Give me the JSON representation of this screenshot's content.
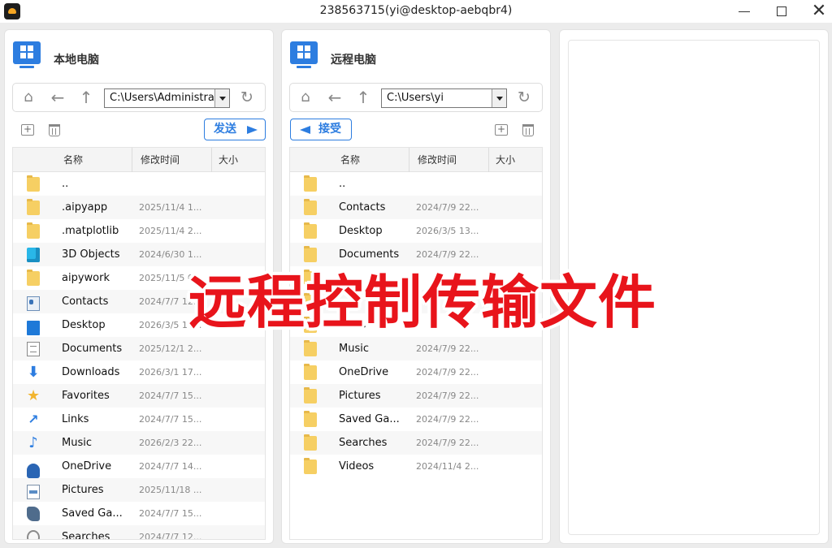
{
  "window": {
    "title": "238563715(yi@desktop-aebqbr4)",
    "minimize_icon": "minimize-icon",
    "maximize_icon": "maximize-icon",
    "close_icon": "close-icon"
  },
  "local": {
    "title": "本地电脑",
    "path": "C:\\Users\\Administrator",
    "action_label": "发送",
    "columns": [
      "名称",
      "修改时间",
      "大小"
    ],
    "files": [
      {
        "name": "..",
        "modified": "",
        "icon": "folder-icon"
      },
      {
        "name": ".aipyapp",
        "modified": "2025/11/4 1...",
        "icon": "folder-icon"
      },
      {
        "name": ".matplotlib",
        "modified": "2025/11/4 2...",
        "icon": "folder-icon"
      },
      {
        "name": "3D Objects",
        "modified": "2024/6/30 1...",
        "icon": "cube-icon"
      },
      {
        "name": "aipywork",
        "modified": "2025/11/5 0...",
        "icon": "folder-icon"
      },
      {
        "name": "Contacts",
        "modified": "2024/7/7 12...",
        "icon": "contacts-icon"
      },
      {
        "name": "Desktop",
        "modified": "2026/3/5 10...",
        "icon": "desktop-icon"
      },
      {
        "name": "Documents",
        "modified": "2025/12/1 2...",
        "icon": "documents-icon"
      },
      {
        "name": "Downloads",
        "modified": "2026/3/1 17...",
        "icon": "download-icon"
      },
      {
        "name": "Favorites",
        "modified": "2024/7/7 15...",
        "icon": "star-icon"
      },
      {
        "name": "Links",
        "modified": "2024/7/7 15...",
        "icon": "link-icon"
      },
      {
        "name": "Music",
        "modified": "2026/2/3 22...",
        "icon": "music-icon"
      },
      {
        "name": "OneDrive",
        "modified": "2024/7/7 14...",
        "icon": "cloud-icon"
      },
      {
        "name": "Pictures",
        "modified": "2025/11/18 ...",
        "icon": "pictures-icon"
      },
      {
        "name": "Saved Ga...",
        "modified": "2024/7/7 15...",
        "icon": "games-icon"
      },
      {
        "name": "Searches",
        "modified": "2024/7/7 12...",
        "icon": "search-icon"
      }
    ]
  },
  "remote": {
    "title": "远程电脑",
    "path": "C:\\Users\\yi",
    "action_label": "接受",
    "columns": [
      "名称",
      "修改时间",
      "大小"
    ],
    "files": [
      {
        "name": "..",
        "modified": "",
        "icon": "folder-icon"
      },
      {
        "name": "Contacts",
        "modified": "2024/7/9 22...",
        "icon": "folder-icon"
      },
      {
        "name": "Desktop",
        "modified": "2026/3/5 13...",
        "icon": "folder-icon"
      },
      {
        "name": "Documents",
        "modified": "2024/7/9 22...",
        "icon": "folder-icon"
      },
      {
        "name": "",
        "modified": "",
        "icon": "folder-icon"
      },
      {
        "name": "",
        "modified": "",
        "icon": "folder-icon"
      },
      {
        "name": "Links",
        "modified": "",
        "icon": "folder-icon"
      },
      {
        "name": "Music",
        "modified": "2024/7/9 22...",
        "icon": "folder-icon"
      },
      {
        "name": "OneDrive",
        "modified": "2024/7/9 22...",
        "icon": "folder-icon"
      },
      {
        "name": "Pictures",
        "modified": "2024/7/9 22...",
        "icon": "folder-icon"
      },
      {
        "name": "Saved Ga...",
        "modified": "2024/7/9 22...",
        "icon": "folder-icon"
      },
      {
        "name": "Searches",
        "modified": "2024/7/9 22...",
        "icon": "folder-icon"
      },
      {
        "name": "Videos",
        "modified": "2024/11/4 2...",
        "icon": "folder-icon"
      }
    ]
  },
  "overlay_caption": "远程控制传输文件",
  "colors": {
    "accent": "#2d7de0",
    "folder": "#f6cf63",
    "caption": "#e8141b"
  }
}
